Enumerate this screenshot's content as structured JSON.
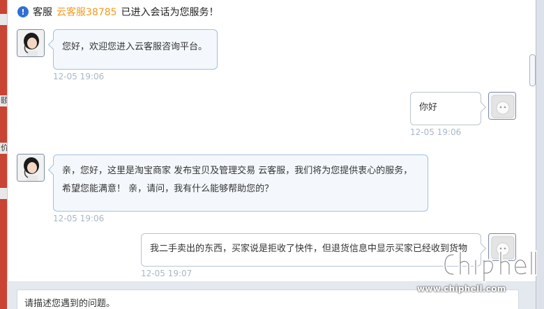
{
  "left_edge_ticks": [
    "",
    "颐",
    "价",
    "",
    "",
    ""
  ],
  "system_notice": {
    "prefix": "客服",
    "agent_name": "云客服38785",
    "suffix": "已进入会话为您服务！",
    "icon": "info-icon"
  },
  "messages": [
    {
      "sender": "agent",
      "text_lines": [
        "您好，欢迎您进入云客服咨询平台。"
      ],
      "time": "12-05 19:06"
    },
    {
      "sender": "user",
      "text_lines": [
        "你好"
      ],
      "time": "12-05 19:06"
    },
    {
      "sender": "agent",
      "text_lines": [
        "亲，您好，这里是淘宝商家 发布宝贝及管理交易 云客服，我们将为您提供衷心的服务，",
        "希望您能满意！ 亲，请问，我有什么能够帮助您的？"
      ],
      "time": "12-05 19:06"
    },
    {
      "sender": "user",
      "text_lines": [
        "我二手卖出的东西，买家说是拒收了快件，但退货信息中显示买家已经收到货物"
      ],
      "time": "12-05 19:07"
    }
  ],
  "input": {
    "placeholder": "请描述您遇到的问题。"
  },
  "watermark": {
    "logo_text": "chip hell",
    "url": "www.chiphell.com"
  },
  "colors": {
    "agent_bubble_bg": "#f4f8fc",
    "agent_bubble_border": "#9fc1e0",
    "timestamp": "#a8b6c6",
    "highlight": "#f39a1d"
  }
}
